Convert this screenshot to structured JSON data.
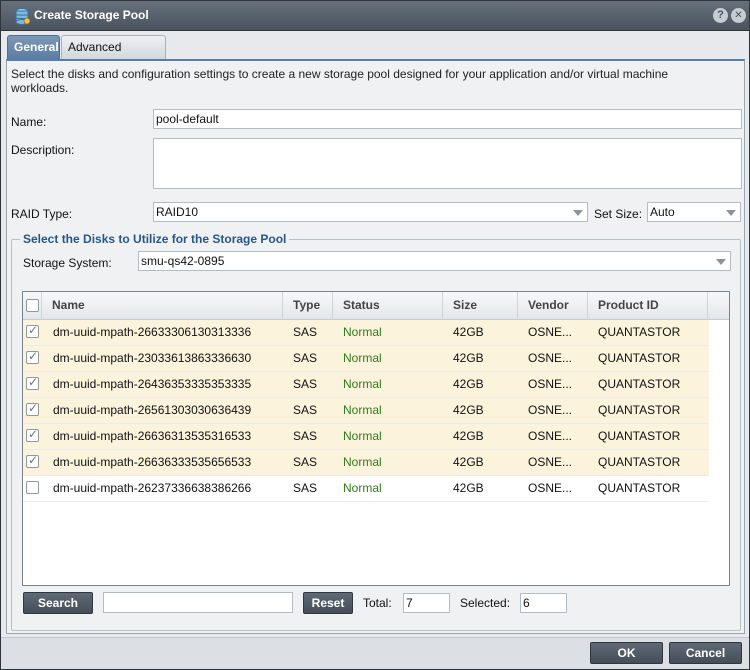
{
  "window": {
    "title": "Create Storage Pool",
    "icons": {
      "app": "storage-pool-icon",
      "help": "help-icon",
      "close": "close-icon"
    },
    "help_glyph": "?",
    "close_glyph": "✕"
  },
  "tabs": [
    {
      "label": "General",
      "active": true
    },
    {
      "label": "Advanced Settings",
      "active": false
    }
  ],
  "intro": "Select the disks and configuration settings to create a new storage pool designed for your application and/or virtual machine workloads.",
  "form": {
    "name_label": "Name:",
    "name_value": "pool-default",
    "description_label": "Description:",
    "description_value": "",
    "raid_label": "RAID Type:",
    "raid_value": "RAID10",
    "set_size_label": "Set Size:",
    "set_size_value": "Auto"
  },
  "disks": {
    "legend": "Select the Disks to Utilize for the Storage Pool",
    "storage_system_label": "Storage System:",
    "storage_system_value": "smu-qs42-0895",
    "columns": [
      "Name",
      "Type",
      "Status",
      "Size",
      "Vendor",
      "Product ID"
    ],
    "rows": [
      {
        "selected": true,
        "name": "dm-uuid-mpath-26633306130313336",
        "type": "SAS",
        "status": "Normal",
        "size": "42GB",
        "vendor": "OSNE...",
        "product_id": "QUANTASTOR"
      },
      {
        "selected": true,
        "name": "dm-uuid-mpath-23033613863336630",
        "type": "SAS",
        "status": "Normal",
        "size": "42GB",
        "vendor": "OSNE...",
        "product_id": "QUANTASTOR"
      },
      {
        "selected": true,
        "name": "dm-uuid-mpath-26436353335353335",
        "type": "SAS",
        "status": "Normal",
        "size": "42GB",
        "vendor": "OSNE...",
        "product_id": "QUANTASTOR"
      },
      {
        "selected": true,
        "name": "dm-uuid-mpath-26561303030636439",
        "type": "SAS",
        "status": "Normal",
        "size": "42GB",
        "vendor": "OSNE...",
        "product_id": "QUANTASTOR"
      },
      {
        "selected": true,
        "name": "dm-uuid-mpath-26636313535316533",
        "type": "SAS",
        "status": "Normal",
        "size": "42GB",
        "vendor": "OSNE...",
        "product_id": "QUANTASTOR"
      },
      {
        "selected": true,
        "name": "dm-uuid-mpath-26636333535656533",
        "type": "SAS",
        "status": "Normal",
        "size": "42GB",
        "vendor": "OSNE...",
        "product_id": "QUANTASTOR"
      },
      {
        "selected": false,
        "name": "dm-uuid-mpath-26237336638386266",
        "type": "SAS",
        "status": "Normal",
        "size": "42GB",
        "vendor": "OSNE...",
        "product_id": "QUANTASTOR"
      }
    ],
    "search_button": "Search",
    "search_value": "",
    "reset_button": "Reset",
    "total_label": "Total:",
    "total_value": "7",
    "selected_label": "Selected:",
    "selected_value": "6"
  },
  "footer": {
    "ok_label": "OK",
    "cancel_label": "Cancel"
  },
  "colors": {
    "titlebar": "#4b545e",
    "tab_active": "#5c7ca3",
    "legend_text": "#28568a",
    "status_normal": "#2e7d1a",
    "selected_row": "#fbf3db"
  }
}
